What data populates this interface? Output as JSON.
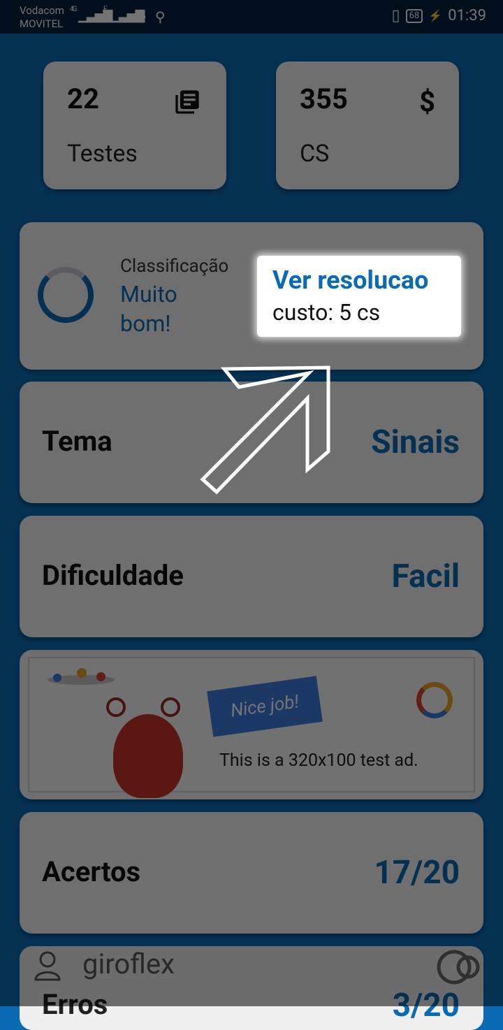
{
  "status_bar": {
    "carrier1": "Vodacom",
    "carrier2": "MOVITEL",
    "net1": "4G",
    "net2": "E",
    "battery": "68",
    "time": "01:39"
  },
  "stats": {
    "tests_count": "22",
    "tests_label": "Testes",
    "tests_icon": "library-books-icon",
    "coins_count": "355",
    "coins_label": "CS",
    "coins_icon": "$"
  },
  "classification": {
    "label": "Classificação",
    "value_line1": "Muito",
    "value_line2": "bom!"
  },
  "tooltip": {
    "title": "Ver resolucao",
    "cost": "custo: 5 cs"
  },
  "rows": {
    "tema_label": "Tema",
    "tema_value": "Sinais",
    "dificuldade_label": "Dificuldade",
    "dificuldade_value": "Facil",
    "acertos_label": "Acertos",
    "acertos_value": "17/20",
    "erros_label": "Erros",
    "erros_value": "3/20"
  },
  "ad": {
    "flag_text": "Nice job!",
    "text": "This is a 320x100 test ad."
  },
  "footer": {
    "username": "giroflex"
  },
  "colors": {
    "accent": "#0a6ab3",
    "card": "#f7f7f7",
    "status_bar": "#03233e"
  }
}
